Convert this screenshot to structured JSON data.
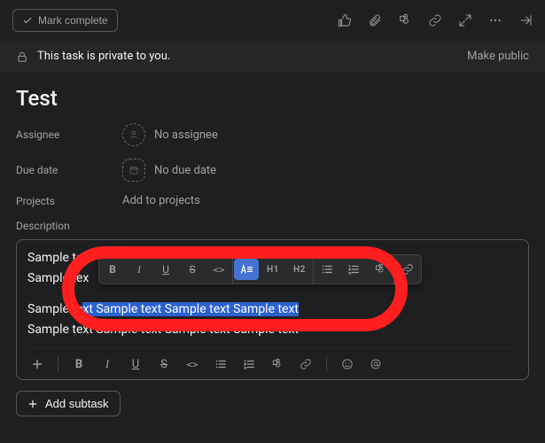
{
  "topbar": {
    "mark_complete": "Mark complete"
  },
  "privacy": {
    "message": "This task is private to you.",
    "make_public": "Make public"
  },
  "task": {
    "title": "Test"
  },
  "fields": {
    "assignee_label": "Assignee",
    "assignee_value": "No assignee",
    "due_date_label": "Due date",
    "due_date_value": "No due date",
    "projects_label": "Projects",
    "projects_value": "Add to projects",
    "description_label": "Description"
  },
  "description": {
    "line1_prefix": "Sample text ",
    "line2_prefix": "Sample tex",
    "line3": "Sample text Sample text Sample text Sample text",
    "line3_prefix": "Sample te",
    "line3_highlight": "xt Sample text Sample text Sample text",
    "line4": "Sample text Sample text Sample text Sample text"
  },
  "float_toolbar": {
    "bold": "B",
    "italic": "I",
    "underline": "U",
    "strike": "S",
    "code": "<>",
    "paragraph": "A≡",
    "h1": "H1",
    "h2": "H2"
  },
  "bottom_toolbar": {
    "bold": "B",
    "italic": "I",
    "underline": "U",
    "strike": "S",
    "code": "<>"
  },
  "subtask": {
    "add_label": "Add subtask"
  }
}
